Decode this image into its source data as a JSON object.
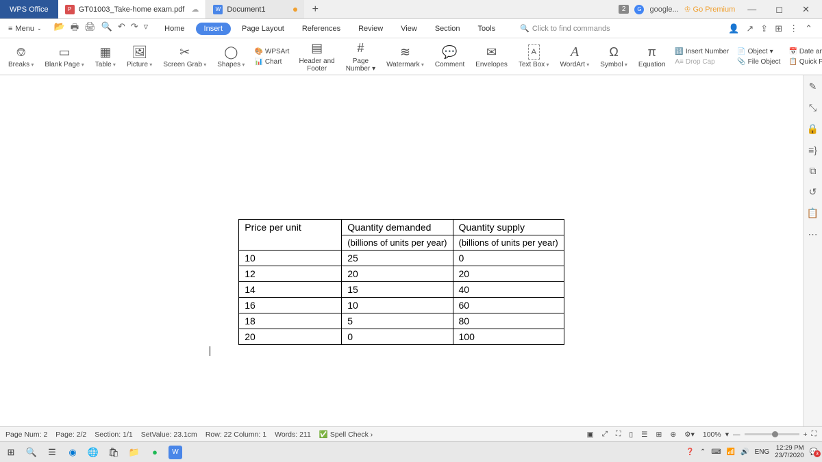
{
  "titlebar": {
    "app": "WPS Office",
    "file_tab": "GT01003_Take-home exam.pdf",
    "doc_tab": "Document1",
    "badge": "2",
    "google": "google...",
    "premium": "Go Premium"
  },
  "menubar": {
    "menu": "Menu",
    "tabs": [
      "Home",
      "Insert",
      "Page Layout",
      "References",
      "Review",
      "View",
      "Section",
      "Tools"
    ],
    "active_tab": "Insert",
    "search_placeholder": "Click to find commands"
  },
  "ribbon": {
    "items": [
      {
        "label": "Breaks",
        "icon": "⎊"
      },
      {
        "label": "Blank Page",
        "icon": "▭"
      },
      {
        "label": "Table",
        "icon": "▦"
      },
      {
        "label": "Picture",
        "icon": "🖼"
      },
      {
        "label": "Screen Grab",
        "icon": "✂"
      },
      {
        "label": "Shapes",
        "icon": "◯"
      },
      {
        "label": "Chart",
        "icon": "📊"
      },
      {
        "label": "Header and Footer",
        "icon": "▤"
      },
      {
        "label": "Page Number",
        "icon": "#"
      },
      {
        "label": "Watermark",
        "icon": "≋"
      },
      {
        "label": "Comment",
        "icon": "💬"
      },
      {
        "label": "Envelopes",
        "icon": "✉"
      },
      {
        "label": "Text Box",
        "icon": "A"
      },
      {
        "label": "WordArt",
        "icon": "A"
      },
      {
        "label": "Symbol",
        "icon": "Ω"
      },
      {
        "label": "Equation",
        "icon": "π"
      }
    ],
    "wpsart": "WPSArt",
    "right": {
      "insert_number": "Insert Number",
      "object": "Object",
      "date_time": "Date and Tim",
      "drop_cap": "Drop Cap",
      "file_object": "File Object",
      "quick_parts": "Quick Parts"
    }
  },
  "table": {
    "headers": [
      "Price per unit",
      "Quantity demanded",
      "Quantity supply"
    ],
    "subheaders": [
      "",
      "(billions of units per year)",
      "(billions of units per year)"
    ],
    "rows": [
      [
        "10",
        "25",
        "0"
      ],
      [
        "12",
        "20",
        "20"
      ],
      [
        "14",
        "15",
        "40"
      ],
      [
        "16",
        "10",
        "60"
      ],
      [
        "18",
        "5",
        "80"
      ],
      [
        "20",
        "0",
        "100"
      ]
    ]
  },
  "statusbar": {
    "page_num": "Page Num: 2",
    "page": "Page: 2/2",
    "section": "Section: 1/1",
    "setvalue": "SetValue: 23.1cm",
    "rowcol": "Row: 22 Column: 1",
    "words": "Words: 211",
    "spell": "Spell Check",
    "zoom": "100%"
  },
  "taskbar": {
    "lang": "ENG",
    "time": "12:29 PM",
    "date": "23/7/2020"
  }
}
